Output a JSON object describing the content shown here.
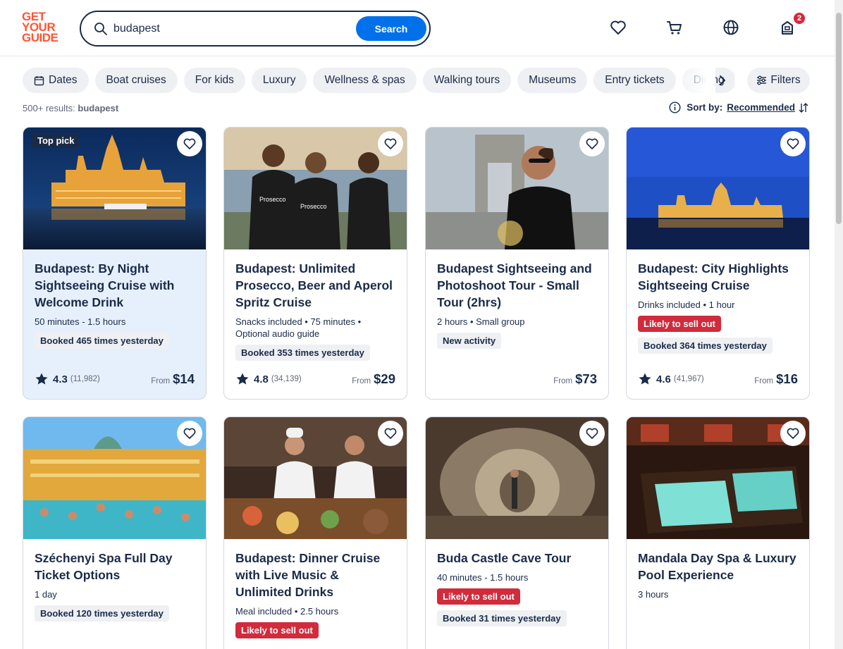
{
  "logo": {
    "line1": "GET",
    "line2": "YOUR",
    "line3": "GUIDE"
  },
  "search": {
    "value": "budapest",
    "button": "Search"
  },
  "header": {
    "cart_badge": "2"
  },
  "chips": [
    "Dates",
    "Boat cruises",
    "For kids",
    "Luxury",
    "Wellness & spas",
    "Walking tours",
    "Museums",
    "Entry tickets",
    "Dining"
  ],
  "filters_label": "Filters",
  "results": {
    "count": "500+ results:",
    "query": "budapest"
  },
  "sort": {
    "label": "Sort by:",
    "value": "Recommended"
  },
  "colors": {
    "accent": "#0071eb",
    "brand": "#ff5533",
    "alert": "#d12b3c",
    "text": "#1a2b49"
  },
  "cards": [
    {
      "badge": "Top pick",
      "title": "Budapest: By Night Sightseeing Cruise with Welcome Drink",
      "meta": "50 minutes - 1.5 hours",
      "tag1": "Booked 465 times yesterday",
      "rating": "4.3",
      "reviews": "(11,982)",
      "from": "From",
      "price": "$14"
    },
    {
      "title": "Budapest: Unlimited Prosecco, Beer and Aperol Spritz Cruise",
      "meta": "Snacks included • 75 minutes • Optional audio guide",
      "tag1": "Booked 353 times yesterday",
      "rating": "4.8",
      "reviews": "(34,139)",
      "from": "From",
      "price": "$29"
    },
    {
      "title": "Budapest Sightseeing and Photoshoot Tour - Small Tour (2hrs)",
      "meta": "2 hours • Small group",
      "tag1": "New activity",
      "from": "From",
      "price": "$73"
    },
    {
      "title": "Budapest: City Highlights Sightseeing Cruise",
      "meta": "Drinks included • 1 hour",
      "tag_red": "Likely to sell out",
      "tag1": "Booked 364 times yesterday",
      "rating": "4.6",
      "reviews": "(41,967)",
      "from": "From",
      "price": "$16"
    },
    {
      "title": "Széchenyi Spa Full Day Ticket Options",
      "meta": "1 day",
      "tag1": "Booked 120 times yesterday"
    },
    {
      "title": "Budapest: Dinner Cruise with Live Music & Unlimited Drinks",
      "meta": "Meal included • 2.5 hours",
      "tag_red": "Likely to sell out"
    },
    {
      "title": "Buda Castle Cave Tour",
      "meta": "40 minutes - 1.5 hours",
      "tag_red": "Likely to sell out",
      "tag1": "Booked 31 times yesterday"
    },
    {
      "title": "Mandala Day Spa & Luxury Pool Experience",
      "meta": "3 hours"
    }
  ]
}
